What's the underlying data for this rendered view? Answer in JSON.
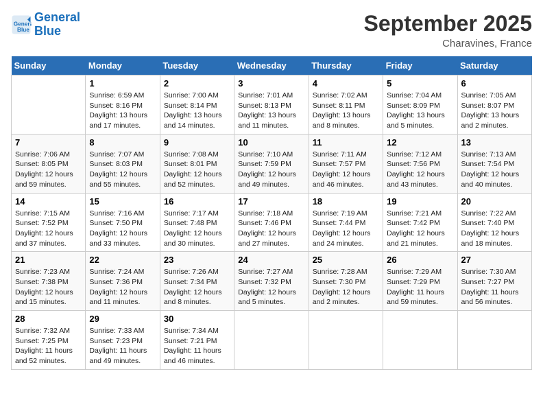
{
  "logo": {
    "line1": "General",
    "line2": "Blue"
  },
  "title": "September 2025",
  "location": "Charavines, France",
  "weekdays": [
    "Sunday",
    "Monday",
    "Tuesday",
    "Wednesday",
    "Thursday",
    "Friday",
    "Saturday"
  ],
  "weeks": [
    [
      {
        "day": "",
        "info": ""
      },
      {
        "day": "1",
        "info": "Sunrise: 6:59 AM\nSunset: 8:16 PM\nDaylight: 13 hours\nand 17 minutes."
      },
      {
        "day": "2",
        "info": "Sunrise: 7:00 AM\nSunset: 8:14 PM\nDaylight: 13 hours\nand 14 minutes."
      },
      {
        "day": "3",
        "info": "Sunrise: 7:01 AM\nSunset: 8:13 PM\nDaylight: 13 hours\nand 11 minutes."
      },
      {
        "day": "4",
        "info": "Sunrise: 7:02 AM\nSunset: 8:11 PM\nDaylight: 13 hours\nand 8 minutes."
      },
      {
        "day": "5",
        "info": "Sunrise: 7:04 AM\nSunset: 8:09 PM\nDaylight: 13 hours\nand 5 minutes."
      },
      {
        "day": "6",
        "info": "Sunrise: 7:05 AM\nSunset: 8:07 PM\nDaylight: 13 hours\nand 2 minutes."
      }
    ],
    [
      {
        "day": "7",
        "info": "Sunrise: 7:06 AM\nSunset: 8:05 PM\nDaylight: 12 hours\nand 59 minutes."
      },
      {
        "day": "8",
        "info": "Sunrise: 7:07 AM\nSunset: 8:03 PM\nDaylight: 12 hours\nand 55 minutes."
      },
      {
        "day": "9",
        "info": "Sunrise: 7:08 AM\nSunset: 8:01 PM\nDaylight: 12 hours\nand 52 minutes."
      },
      {
        "day": "10",
        "info": "Sunrise: 7:10 AM\nSunset: 7:59 PM\nDaylight: 12 hours\nand 49 minutes."
      },
      {
        "day": "11",
        "info": "Sunrise: 7:11 AM\nSunset: 7:57 PM\nDaylight: 12 hours\nand 46 minutes."
      },
      {
        "day": "12",
        "info": "Sunrise: 7:12 AM\nSunset: 7:56 PM\nDaylight: 12 hours\nand 43 minutes."
      },
      {
        "day": "13",
        "info": "Sunrise: 7:13 AM\nSunset: 7:54 PM\nDaylight: 12 hours\nand 40 minutes."
      }
    ],
    [
      {
        "day": "14",
        "info": "Sunrise: 7:15 AM\nSunset: 7:52 PM\nDaylight: 12 hours\nand 37 minutes."
      },
      {
        "day": "15",
        "info": "Sunrise: 7:16 AM\nSunset: 7:50 PM\nDaylight: 12 hours\nand 33 minutes."
      },
      {
        "day": "16",
        "info": "Sunrise: 7:17 AM\nSunset: 7:48 PM\nDaylight: 12 hours\nand 30 minutes."
      },
      {
        "day": "17",
        "info": "Sunrise: 7:18 AM\nSunset: 7:46 PM\nDaylight: 12 hours\nand 27 minutes."
      },
      {
        "day": "18",
        "info": "Sunrise: 7:19 AM\nSunset: 7:44 PM\nDaylight: 12 hours\nand 24 minutes."
      },
      {
        "day": "19",
        "info": "Sunrise: 7:21 AM\nSunset: 7:42 PM\nDaylight: 12 hours\nand 21 minutes."
      },
      {
        "day": "20",
        "info": "Sunrise: 7:22 AM\nSunset: 7:40 PM\nDaylight: 12 hours\nand 18 minutes."
      }
    ],
    [
      {
        "day": "21",
        "info": "Sunrise: 7:23 AM\nSunset: 7:38 PM\nDaylight: 12 hours\nand 15 minutes."
      },
      {
        "day": "22",
        "info": "Sunrise: 7:24 AM\nSunset: 7:36 PM\nDaylight: 12 hours\nand 11 minutes."
      },
      {
        "day": "23",
        "info": "Sunrise: 7:26 AM\nSunset: 7:34 PM\nDaylight: 12 hours\nand 8 minutes."
      },
      {
        "day": "24",
        "info": "Sunrise: 7:27 AM\nSunset: 7:32 PM\nDaylight: 12 hours\nand 5 minutes."
      },
      {
        "day": "25",
        "info": "Sunrise: 7:28 AM\nSunset: 7:30 PM\nDaylight: 12 hours\nand 2 minutes."
      },
      {
        "day": "26",
        "info": "Sunrise: 7:29 AM\nSunset: 7:29 PM\nDaylight: 11 hours\nand 59 minutes."
      },
      {
        "day": "27",
        "info": "Sunrise: 7:30 AM\nSunset: 7:27 PM\nDaylight: 11 hours\nand 56 minutes."
      }
    ],
    [
      {
        "day": "28",
        "info": "Sunrise: 7:32 AM\nSunset: 7:25 PM\nDaylight: 11 hours\nand 52 minutes."
      },
      {
        "day": "29",
        "info": "Sunrise: 7:33 AM\nSunset: 7:23 PM\nDaylight: 11 hours\nand 49 minutes."
      },
      {
        "day": "30",
        "info": "Sunrise: 7:34 AM\nSunset: 7:21 PM\nDaylight: 11 hours\nand 46 minutes."
      },
      {
        "day": "",
        "info": ""
      },
      {
        "day": "",
        "info": ""
      },
      {
        "day": "",
        "info": ""
      },
      {
        "day": "",
        "info": ""
      }
    ]
  ]
}
